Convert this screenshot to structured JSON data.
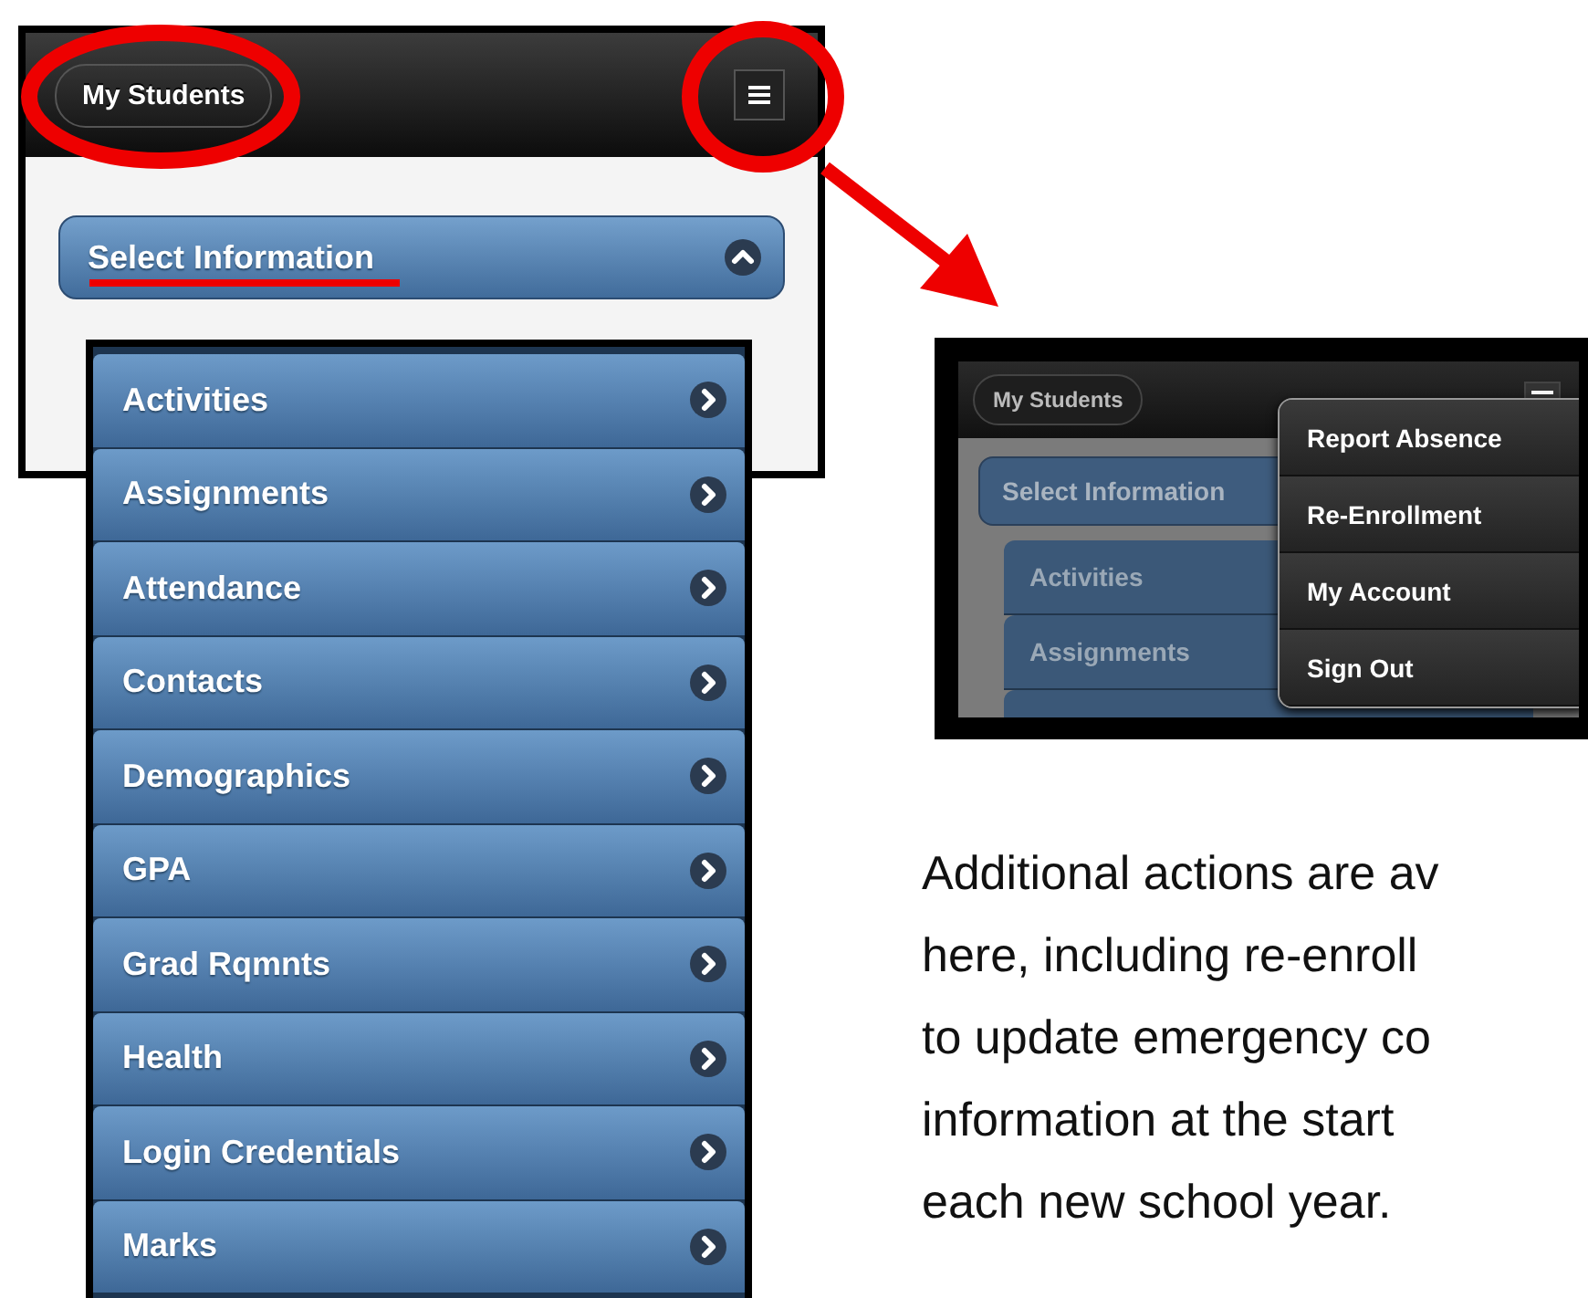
{
  "main_screen": {
    "back_button": "My Students",
    "select_bar": {
      "label": "Select Information",
      "expanded": true
    },
    "items": [
      {
        "label": "Activities"
      },
      {
        "label": "Assignments"
      },
      {
        "label": "Attendance"
      },
      {
        "label": "Contacts"
      },
      {
        "label": "Demographics"
      },
      {
        "label": "GPA"
      },
      {
        "label": "Grad Rqmnts"
      },
      {
        "label": "Health"
      },
      {
        "label": "Login Credentials"
      },
      {
        "label": "Marks"
      }
    ]
  },
  "menu_screen": {
    "back_button": "My Students",
    "select_bar": {
      "label": "Select Information"
    },
    "items": [
      {
        "label": "Activities"
      },
      {
        "label": "Assignments"
      }
    ],
    "menu": [
      {
        "label": "Report Absence"
      },
      {
        "label": "Re-Enrollment"
      },
      {
        "label": "My Account"
      },
      {
        "label": "Sign Out"
      }
    ]
  },
  "caption": {
    "lines": [
      "Additional actions are av",
      "here, including re-enroll",
      "to update emergency co",
      "information at the start",
      "each new school year."
    ]
  }
}
